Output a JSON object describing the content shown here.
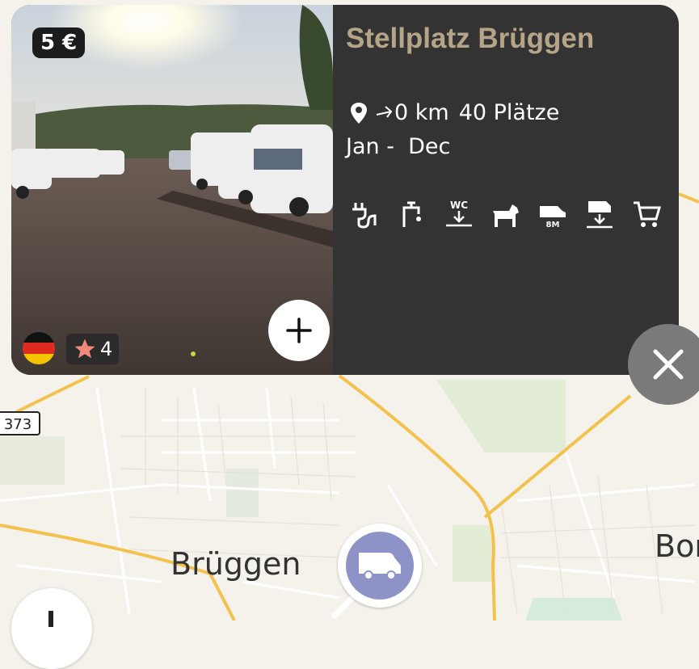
{
  "map": {
    "place_label": "Brüggen",
    "edge_label": "Bor",
    "road_number": "373",
    "colors": {
      "land": "#f5f2ec",
      "road_major": "#f3c24d",
      "road_minor": "#ffffff",
      "green": "#e3ecd5"
    }
  },
  "card": {
    "price": "5 €",
    "title": "Stellplatz Brüggen",
    "distance": "0 km",
    "spots": "40 Plätze",
    "season": "Jan -  Dec",
    "rating": "4",
    "country_flag": "germany-flag",
    "title_color": "#b6a488",
    "background": "#333333",
    "amenities": [
      {
        "name": "electricity-icon"
      },
      {
        "name": "water-tap-icon"
      },
      {
        "name": "wc-dump-icon"
      },
      {
        "name": "dog-icon"
      },
      {
        "name": "max-length-icon",
        "label": "8M"
      },
      {
        "name": "waste-dump-icon"
      },
      {
        "name": "shopping-cart-icon"
      }
    ],
    "wc_label": "WC"
  },
  "buttons": {
    "add_label": "+",
    "close_label": "×"
  },
  "marker": {
    "color": "#8d93c7",
    "icon": "motorhome-icon"
  }
}
